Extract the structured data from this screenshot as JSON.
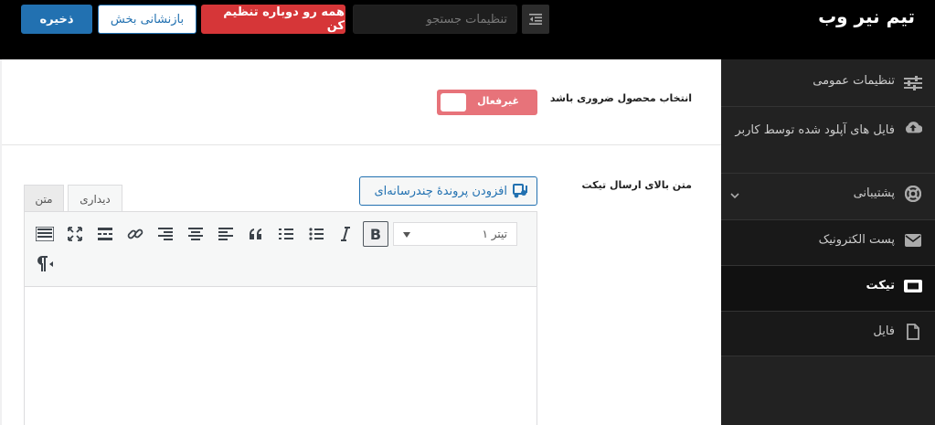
{
  "header": {
    "brand": "تیم نیر وب",
    "save_label": "ذخیره",
    "reset_section_label": "بازنشانی بخش",
    "reset_all_label": "همه رو دوباره تنظیم کن",
    "search_placeholder": "تنظیمات جستجو"
  },
  "sidebar": {
    "items": [
      {
        "label": "تنظیمات عمومی",
        "icon": "sliders-icon"
      },
      {
        "label": "فایل های آپلود شده توسط کاربر",
        "icon": "cloud-upload-icon"
      },
      {
        "label": "پشتیبانی",
        "icon": "lifebuoy-icon"
      },
      {
        "label": "پست الکترونیک",
        "icon": "envelope-icon"
      },
      {
        "label": "تیکت",
        "icon": "ticket-icon",
        "active": true
      },
      {
        "label": "فایل",
        "icon": "file-icon"
      }
    ]
  },
  "fields": {
    "required_product_title": "انتخاب محصول ضروری باشد",
    "required_product_toggle": "غیرفعال",
    "ticket_top_text_title": "متن بالای ارسال تیکت"
  },
  "editor": {
    "add_media_label": "افزودن پروندهٔ چندرسانه‌ای",
    "tab_visual": "دیداری",
    "tab_text": "متن",
    "format_value": "تیتر ۱",
    "bold_label": "B"
  },
  "colors": {
    "accent": "#2271b1",
    "danger": "#d63638",
    "toggle_off": "#e7737a",
    "sidebar_bg": "#222222"
  }
}
